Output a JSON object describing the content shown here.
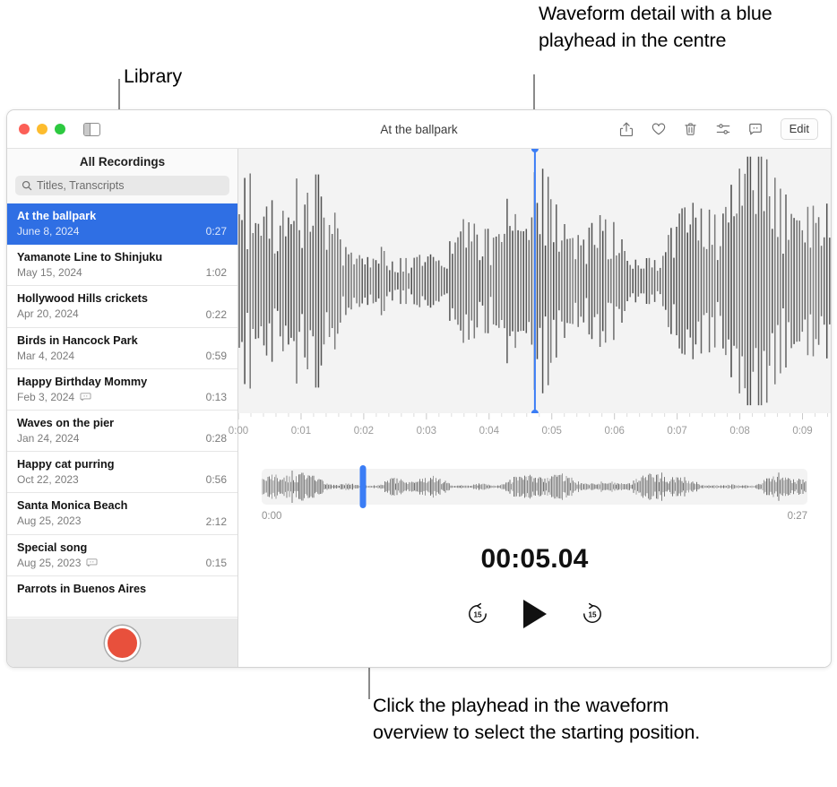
{
  "callouts": {
    "library": "Library",
    "waveform_detail": "Waveform detail with a blue playhead in the centre",
    "playhead_click": "Click the playhead in the waveform overview to select the starting position."
  },
  "window": {
    "title": "At the ballpark",
    "traffic_lights": [
      "close-red",
      "minimize-yellow",
      "zoom-green"
    ],
    "sidebar_toggle_icon": "sidebar-toggle-icon",
    "toolbar": {
      "share_icon": "share-icon",
      "favorite_icon": "heart-icon",
      "delete_icon": "trash-icon",
      "enhance_icon": "audio-sliders-icon",
      "transcript_icon": "transcript-bubble-icon",
      "edit_label": "Edit"
    }
  },
  "sidebar": {
    "header_title": "All Recordings",
    "search": {
      "placeholder": "Titles, Transcripts",
      "value": "",
      "icon": "search-icon"
    },
    "recordings": [
      {
        "title": "At the ballpark",
        "date": "June 8, 2024",
        "duration": "0:27",
        "transcript": false,
        "selected": true
      },
      {
        "title": "Yamanote Line to Shinjuku",
        "date": "May 15, 2024",
        "duration": "1:02",
        "transcript": false,
        "selected": false
      },
      {
        "title": "Hollywood Hills crickets",
        "date": "Apr 20, 2024",
        "duration": "0:22",
        "transcript": false,
        "selected": false
      },
      {
        "title": "Birds in Hancock Park",
        "date": "Mar 4, 2024",
        "duration": "0:59",
        "transcript": false,
        "selected": false
      },
      {
        "title": "Happy Birthday Mommy",
        "date": "Feb 3, 2024",
        "duration": "0:13",
        "transcript": true,
        "selected": false
      },
      {
        "title": "Waves on the pier",
        "date": "Jan 24, 2024",
        "duration": "0:28",
        "transcript": false,
        "selected": false
      },
      {
        "title": "Happy cat purring",
        "date": "Oct 22, 2023",
        "duration": "0:56",
        "transcript": false,
        "selected": false
      },
      {
        "title": "Santa Monica Beach",
        "date": "Aug 25, 2023",
        "duration": "2:12",
        "transcript": false,
        "selected": false
      },
      {
        "title": "Special song",
        "date": "Aug 25, 2023",
        "duration": "0:15",
        "transcript": true,
        "selected": false
      },
      {
        "title": "Parrots in Buenos Aires",
        "date": "",
        "duration": "",
        "transcript": false,
        "selected": false
      }
    ],
    "record_button": "record-button"
  },
  "player": {
    "ruler_ticks": [
      "0:00",
      "0:01",
      "0:02",
      "0:03",
      "0:04",
      "0:05",
      "0:06",
      "0:07",
      "0:08",
      "0:09"
    ],
    "overview_start": "0:00",
    "overview_end": "0:27",
    "timecode": "00:05.04",
    "playhead_position_percent": 50,
    "overview_playhead_percent": 18.6,
    "transport": {
      "skip_back_label": "15",
      "play_label": "play-icon",
      "skip_forward_label": "15"
    }
  },
  "colors": {
    "accent_blue": "#2f6fe4",
    "playhead_blue": "#3b7df5",
    "record_red": "#e8503c",
    "waveform_gray": "#5d5d5d",
    "panel_gray": "#f3f3f3"
  }
}
